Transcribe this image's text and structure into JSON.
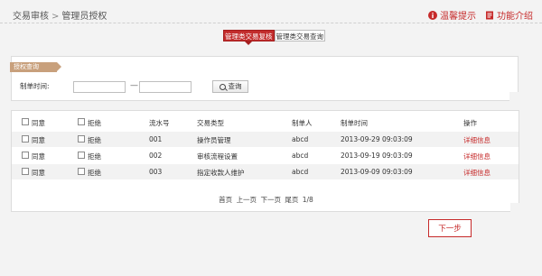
{
  "breadcrumb": {
    "parent": "交易审核",
    "separator": ">",
    "current": "管理员授权"
  },
  "top_links": [
    {
      "label": "温馨提示",
      "icon": "info-icon"
    },
    {
      "label": "功能介绍",
      "icon": "document-icon"
    }
  ],
  "tabs": [
    {
      "label": "管理类交易复核",
      "active": true
    },
    {
      "label": "管理类交易查询",
      "active": false
    }
  ],
  "query": {
    "ribbon_label": "授权查询",
    "date_label": "制单时间:",
    "date_start_value": "",
    "date_end_value": "",
    "range_separator": "—",
    "query_button": "查询"
  },
  "table": {
    "headers": {
      "agree": "同意",
      "reject": "拒绝",
      "serial": "流水号",
      "type": "交易类型",
      "creator": "制单人",
      "time": "制单时间",
      "action": "操作"
    },
    "rows": [
      {
        "agree": "同意",
        "reject": "拒绝",
        "serial": "001",
        "type": "操作员管理",
        "creator": "abcd",
        "time": "2013-09-29 09:03:09",
        "action": "详细信息"
      },
      {
        "agree": "同意",
        "reject": "拒绝",
        "serial": "002",
        "type": "审核流程设置",
        "creator": "abcd",
        "time": "2013-09-19 09:03:09",
        "action": "详细信息"
      },
      {
        "agree": "同意",
        "reject": "拒绝",
        "serial": "003",
        "type": "指定收款人维护",
        "creator": "abcd",
        "time": "2013-09-09 09:03:09",
        "action": "详细信息"
      }
    ]
  },
  "pager": {
    "first": "首页",
    "prev": "上一页",
    "next": "下一页",
    "last": "尾页",
    "page_info": "1/8"
  },
  "next_button": "下一步",
  "colors": {
    "accent": "#c62a2a",
    "ribbon": "#c8a07c",
    "alt_row": "#f2f2f2"
  }
}
